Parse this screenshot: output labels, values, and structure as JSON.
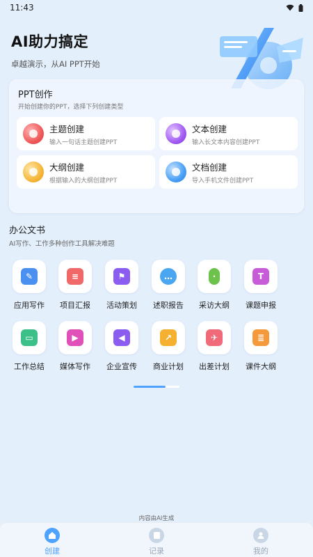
{
  "status_bar": {
    "time": "11:43"
  },
  "hero": {
    "title": "AI助力搞定",
    "subtitle": "卓越演示，从AI PPT开始"
  },
  "ppt_section": {
    "title": "PPT创作",
    "subtitle": "开始创建你的PPT，选择下列创建类型",
    "items": [
      {
        "title": "主题创建",
        "desc": "输入一句话主题创建PPT",
        "icon": "theme-orb-icon",
        "color": "#f05a5a"
      },
      {
        "title": "文本创建",
        "desc": "输入长文本内容创建PPT",
        "icon": "text-orb-icon",
        "color": "#a25cf2"
      },
      {
        "title": "大纲创建",
        "desc": "根据输入的大纲创建PPT",
        "icon": "outline-orb-icon",
        "color": "#f5b73b"
      },
      {
        "title": "文档创建",
        "desc": "导入手机文件创建PPT",
        "icon": "document-orb-icon",
        "color": "#4aa0f5"
      }
    ]
  },
  "office_section": {
    "title": "办公文书",
    "subtitle": "AI写作、工作多种创作工具解决难题",
    "tools": [
      {
        "label": "应用写作",
        "icon": "pen-doc-icon",
        "color": "#4a90f0"
      },
      {
        "label": "项目汇报",
        "icon": "report-icon",
        "color": "#f06868"
      },
      {
        "label": "活动策划",
        "icon": "flag-icon",
        "color": "#8a5cf0"
      },
      {
        "label": "述职报告",
        "icon": "chat-bubble-icon",
        "color": "#4aa6f0"
      },
      {
        "label": "采访大纲",
        "icon": "microphone-icon",
        "color": "#6cc24a"
      },
      {
        "label": "课题申报",
        "icon": "text-t-icon",
        "color": "#c85cd8"
      },
      {
        "label": "工作总结",
        "icon": "briefcase-icon",
        "color": "#3cc08a"
      },
      {
        "label": "媒体写作",
        "icon": "video-camera-icon",
        "color": "#e050b8"
      },
      {
        "label": "企业宣传",
        "icon": "megaphone-icon",
        "color": "#8a5cf0"
      },
      {
        "label": "商业计划",
        "icon": "trend-chart-icon",
        "color": "#f5b030"
      },
      {
        "label": "出差计划",
        "icon": "airplane-icon",
        "color": "#f06a7a"
      },
      {
        "label": "课件大纲",
        "icon": "scroll-icon",
        "color": "#f59a3a"
      }
    ]
  },
  "footer_note": "内容由AI生成",
  "bottom_nav": {
    "items": [
      {
        "label": "创建",
        "icon": "home-icon",
        "active": true
      },
      {
        "label": "记录",
        "icon": "records-icon",
        "active": false
      },
      {
        "label": "我的",
        "icon": "profile-icon",
        "active": false
      }
    ]
  },
  "colors": {
    "accent": "#4da3ff",
    "background": "#e4effc",
    "inactive_nav": "#9aa7b8"
  }
}
